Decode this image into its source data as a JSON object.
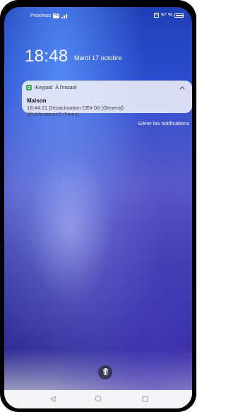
{
  "status_bar": {
    "carrier": "Proximus",
    "network_badge": "HD",
    "battery_text": "97 %",
    "icons": [
      "hd-icon",
      "signal-icon",
      "nfc-icon",
      "battery-icon"
    ]
  },
  "lockscreen": {
    "time": "18:48",
    "date": "Mardi 17 octobre"
  },
  "notification": {
    "app_name": "iKeypad",
    "when": "À l'instant",
    "title": "Maison",
    "body_line1": "18:44:21 Désactivation CE# 00 (General)",
    "body_line2": "@Utilisateur#1 (Nous)",
    "app_icon": "keypad-app-icon",
    "expand_icon": "chevron-up-icon"
  },
  "manage_notifications_label": "Gérer les notifications",
  "clear_button_icon": "trash-icon",
  "nav_bar": {
    "icons": [
      "back-icon",
      "home-icon",
      "recents-icon"
    ]
  },
  "colors": {
    "wallpaper_top": "#1e3fb5",
    "wallpaper_mid": "#5a5fc8",
    "card_bg": "#f0f0f8",
    "app_icon_green": "#2aa84a"
  }
}
